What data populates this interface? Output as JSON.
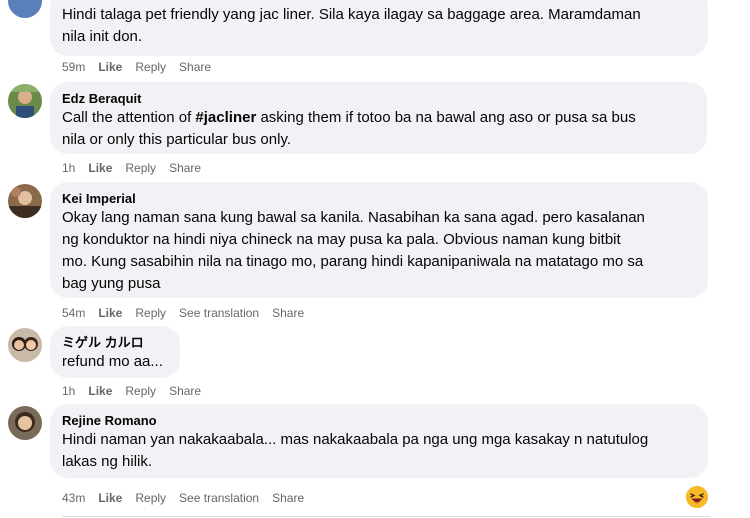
{
  "comments": [
    {
      "author": "",
      "text": "Hindi talaga pet friendly yang jac liner. Sila kaya ilagay sa baggage area. Maramdaman\nnila init don.",
      "time": "59m",
      "like": "Like",
      "reply": "Reply",
      "share": "Share"
    },
    {
      "author": "Edz Beraquit",
      "text_pre": "Call the attention of ",
      "text_tag": "#jacliner",
      "text_post": " asking them if totoo ba na bawal ang aso or pusa sa bus\nnila or only this particular bus only.",
      "time": "1h",
      "like": "Like",
      "reply": "Reply",
      "share": "Share"
    },
    {
      "author": "Kei Imperial",
      "text": "Okay lang naman sana kung bawal sa kanila. Nasabihan ka sana agad. pero kasalanan\nng konduktor na hindi niya chineck na may pusa ka pala. Obvious naman kung bitbit\nmo. Kung sasabihin nila na tinago mo, parang hindi kapanipaniwala na matatago mo sa\nbag yung pusa",
      "time": "54m",
      "like": "Like",
      "reply": "Reply",
      "translate": "See translation",
      "share": "Share"
    },
    {
      "author": "ミゲル カルロ",
      "text": "refund mo aa...",
      "time": "1h",
      "like": "Like",
      "reply": "Reply",
      "share": "Share"
    },
    {
      "author": "Rejine Romano",
      "text": "Hindi naman yan nakakaabala... mas nakakaabala pa nga ung mga kasakay n natutulog\nlakas ng hilik.",
      "time": "43m",
      "like": "Like",
      "reply": "Reply",
      "translate": "See translation",
      "share": "Share"
    }
  ],
  "reaction_icon": "laughing-emoji-icon"
}
